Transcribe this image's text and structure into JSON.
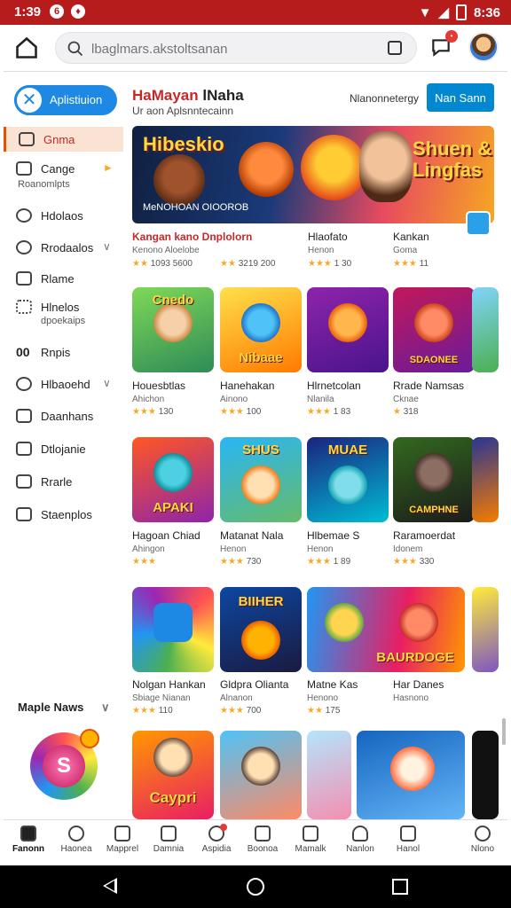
{
  "status_bar": {
    "time": "1:39",
    "right_text": "8:36"
  },
  "top_bar": {
    "search_placeholder": "lbaglmars.akstoltsanan"
  },
  "sidebar": {
    "app_pill": "Aplistiuion",
    "items": [
      {
        "label": "Gnma",
        "sub": ""
      },
      {
        "label": "Cange",
        "sub": "Roanomlpts"
      },
      {
        "label": "Hdolaos",
        "sub": ""
      },
      {
        "label": "Rrodaalos",
        "sub": ""
      },
      {
        "label": "Rlame",
        "sub": ""
      },
      {
        "label": "Hlnelos",
        "sub": "dpoekaips"
      },
      {
        "label": "Rnpis",
        "sub": ""
      },
      {
        "label": "Hlbaoehd",
        "sub": ""
      },
      {
        "label": "Daanhans",
        "sub": ""
      },
      {
        "label": "Dtlojanie",
        "sub": ""
      },
      {
        "label": "Rrarle",
        "sub": ""
      },
      {
        "label": "Staenplos",
        "sub": ""
      }
    ],
    "more_news": "Maple Naws",
    "orb_letter": "S"
  },
  "main": {
    "title_accent": "HaMayan",
    "title_rest": "lNaha",
    "subtitle": "Ur aon Aplsnntecainn",
    "recommend": "Nlanonnetergy",
    "see_button": "Nan Sann",
    "banner": {
      "title_left": "Hibeskio",
      "title_right": "Shuen & Lingfas",
      "caption": "MeNOHOAN OIOOROB"
    },
    "row1": [
      {
        "name": "Kangan kano Dnplolorn",
        "sub": "Kenono Aloelobe",
        "rating": "1093 5600"
      },
      {
        "name": "",
        "sub": "",
        "rating": "3219 200"
      },
      {
        "name": "Hlaofato",
        "sub": "Henon",
        "rating": "1 30"
      },
      {
        "name": "Kankan",
        "sub": "Goma",
        "rating": "11"
      }
    ],
    "row2": [
      {
        "name": "Houesbtlas",
        "sub": "Ahichon",
        "rating": "130",
        "tile": "Cnedo"
      },
      {
        "name": "Hanehakan",
        "sub": "Ainono",
        "rating": "100",
        "tile": "Nibaae"
      },
      {
        "name": "Hlrnetcolan",
        "sub": "Nlanila",
        "rating": "1 83",
        "tile": ""
      },
      {
        "name": "Rrade Namsas",
        "sub": "Cknae",
        "rating": "318",
        "tile": "SDAONEE"
      }
    ],
    "row3": [
      {
        "name": "Hagoan Chiad",
        "sub": "Ahingon",
        "rating": "",
        "tile": "APAKI"
      },
      {
        "name": "Matanat Nala",
        "sub": "Henon",
        "rating": "730",
        "tile": "SHUS"
      },
      {
        "name": "Hlbemae S",
        "sub": "Henon",
        "rating": "1 89",
        "tile": "MUAE"
      },
      {
        "name": "Raramoerdat",
        "sub": "Idonem",
        "rating": "330",
        "tile": "CAMPHNE"
      }
    ],
    "row4": [
      {
        "name": "Nolgan Hankan",
        "sub": "Sbiage Nianan",
        "rating": "110",
        "tile": ""
      },
      {
        "name": "Gldpra Olianta",
        "sub": "Alnanon",
        "rating": "700",
        "tile": "BIIHER"
      },
      {
        "name": "Matne Kas",
        "sub": "Henono",
        "rating": "175",
        "tile": ""
      },
      {
        "name": "Har Danes",
        "sub": "Hasnono",
        "rating": "",
        "tile": "BAURDOGE"
      }
    ],
    "row5_tile": "Caypri"
  },
  "bottom_nav": [
    {
      "label": "Fanonn",
      "icon": "home-icon"
    },
    {
      "label": "Haonea",
      "icon": "chat-icon"
    },
    {
      "label": "Mapprel",
      "icon": "calendar-icon"
    },
    {
      "label": "Damnia",
      "icon": "doc-icon"
    },
    {
      "label": "Aspidia",
      "icon": "gift-icon"
    },
    {
      "label": "Boonoa",
      "icon": "box-icon"
    },
    {
      "label": "Mamalk",
      "icon": "image-icon"
    },
    {
      "label": "Nanlon",
      "icon": "person-icon"
    },
    {
      "label": "Hanol",
      "icon": "mail-icon"
    },
    {
      "label": "Nlono",
      "icon": "info-icon"
    }
  ]
}
